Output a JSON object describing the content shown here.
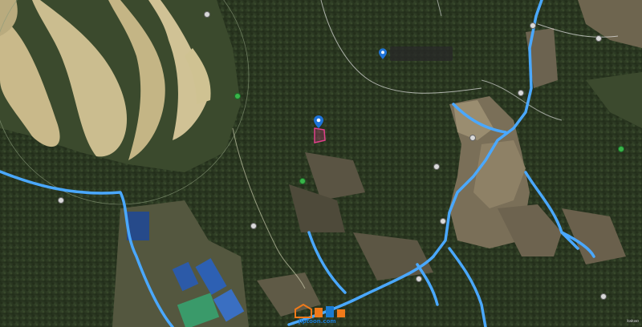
{
  "map": {
    "type": "satellite",
    "accent": "#1e73d8",
    "stream_color": "#4aa8ff",
    "selected_parcel_color": "#e0408a"
  },
  "info_popup": {
    "line1": "",
    "line2": ""
  },
  "selected_marker": {
    "icon": "location-pin-icon"
  },
  "watermark": {
    "text": "jiptoon.com"
  },
  "copyright": {
    "text": "kakao"
  }
}
